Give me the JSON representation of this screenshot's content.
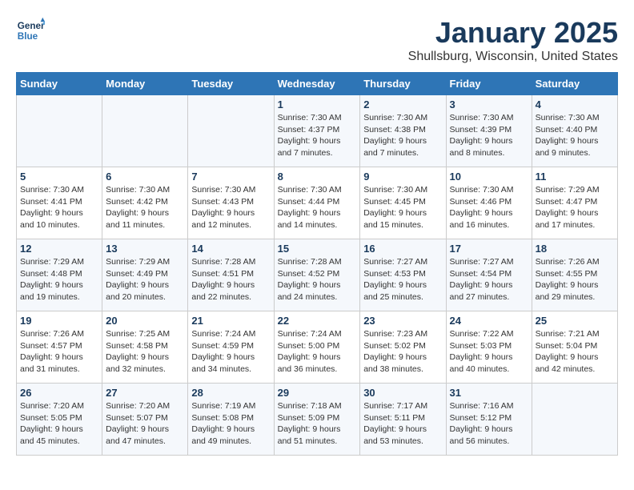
{
  "header": {
    "logo_line1": "General",
    "logo_line2": "Blue",
    "title": "January 2025",
    "subtitle": "Shullsburg, Wisconsin, United States"
  },
  "weekdays": [
    "Sunday",
    "Monday",
    "Tuesday",
    "Wednesday",
    "Thursday",
    "Friday",
    "Saturday"
  ],
  "weeks": [
    [
      {
        "day": "",
        "info": ""
      },
      {
        "day": "",
        "info": ""
      },
      {
        "day": "",
        "info": ""
      },
      {
        "day": "1",
        "info": "Sunrise: 7:30 AM\nSunset: 4:37 PM\nDaylight: 9 hours\nand 7 minutes."
      },
      {
        "day": "2",
        "info": "Sunrise: 7:30 AM\nSunset: 4:38 PM\nDaylight: 9 hours\nand 7 minutes."
      },
      {
        "day": "3",
        "info": "Sunrise: 7:30 AM\nSunset: 4:39 PM\nDaylight: 9 hours\nand 8 minutes."
      },
      {
        "day": "4",
        "info": "Sunrise: 7:30 AM\nSunset: 4:40 PM\nDaylight: 9 hours\nand 9 minutes."
      }
    ],
    [
      {
        "day": "5",
        "info": "Sunrise: 7:30 AM\nSunset: 4:41 PM\nDaylight: 9 hours\nand 10 minutes."
      },
      {
        "day": "6",
        "info": "Sunrise: 7:30 AM\nSunset: 4:42 PM\nDaylight: 9 hours\nand 11 minutes."
      },
      {
        "day": "7",
        "info": "Sunrise: 7:30 AM\nSunset: 4:43 PM\nDaylight: 9 hours\nand 12 minutes."
      },
      {
        "day": "8",
        "info": "Sunrise: 7:30 AM\nSunset: 4:44 PM\nDaylight: 9 hours\nand 14 minutes."
      },
      {
        "day": "9",
        "info": "Sunrise: 7:30 AM\nSunset: 4:45 PM\nDaylight: 9 hours\nand 15 minutes."
      },
      {
        "day": "10",
        "info": "Sunrise: 7:30 AM\nSunset: 4:46 PM\nDaylight: 9 hours\nand 16 minutes."
      },
      {
        "day": "11",
        "info": "Sunrise: 7:29 AM\nSunset: 4:47 PM\nDaylight: 9 hours\nand 17 minutes."
      }
    ],
    [
      {
        "day": "12",
        "info": "Sunrise: 7:29 AM\nSunset: 4:48 PM\nDaylight: 9 hours\nand 19 minutes."
      },
      {
        "day": "13",
        "info": "Sunrise: 7:29 AM\nSunset: 4:49 PM\nDaylight: 9 hours\nand 20 minutes."
      },
      {
        "day": "14",
        "info": "Sunrise: 7:28 AM\nSunset: 4:51 PM\nDaylight: 9 hours\nand 22 minutes."
      },
      {
        "day": "15",
        "info": "Sunrise: 7:28 AM\nSunset: 4:52 PM\nDaylight: 9 hours\nand 24 minutes."
      },
      {
        "day": "16",
        "info": "Sunrise: 7:27 AM\nSunset: 4:53 PM\nDaylight: 9 hours\nand 25 minutes."
      },
      {
        "day": "17",
        "info": "Sunrise: 7:27 AM\nSunset: 4:54 PM\nDaylight: 9 hours\nand 27 minutes."
      },
      {
        "day": "18",
        "info": "Sunrise: 7:26 AM\nSunset: 4:55 PM\nDaylight: 9 hours\nand 29 minutes."
      }
    ],
    [
      {
        "day": "19",
        "info": "Sunrise: 7:26 AM\nSunset: 4:57 PM\nDaylight: 9 hours\nand 31 minutes."
      },
      {
        "day": "20",
        "info": "Sunrise: 7:25 AM\nSunset: 4:58 PM\nDaylight: 9 hours\nand 32 minutes."
      },
      {
        "day": "21",
        "info": "Sunrise: 7:24 AM\nSunset: 4:59 PM\nDaylight: 9 hours\nand 34 minutes."
      },
      {
        "day": "22",
        "info": "Sunrise: 7:24 AM\nSunset: 5:00 PM\nDaylight: 9 hours\nand 36 minutes."
      },
      {
        "day": "23",
        "info": "Sunrise: 7:23 AM\nSunset: 5:02 PM\nDaylight: 9 hours\nand 38 minutes."
      },
      {
        "day": "24",
        "info": "Sunrise: 7:22 AM\nSunset: 5:03 PM\nDaylight: 9 hours\nand 40 minutes."
      },
      {
        "day": "25",
        "info": "Sunrise: 7:21 AM\nSunset: 5:04 PM\nDaylight: 9 hours\nand 42 minutes."
      }
    ],
    [
      {
        "day": "26",
        "info": "Sunrise: 7:20 AM\nSunset: 5:05 PM\nDaylight: 9 hours\nand 45 minutes."
      },
      {
        "day": "27",
        "info": "Sunrise: 7:20 AM\nSunset: 5:07 PM\nDaylight: 9 hours\nand 47 minutes."
      },
      {
        "day": "28",
        "info": "Sunrise: 7:19 AM\nSunset: 5:08 PM\nDaylight: 9 hours\nand 49 minutes."
      },
      {
        "day": "29",
        "info": "Sunrise: 7:18 AM\nSunset: 5:09 PM\nDaylight: 9 hours\nand 51 minutes."
      },
      {
        "day": "30",
        "info": "Sunrise: 7:17 AM\nSunset: 5:11 PM\nDaylight: 9 hours\nand 53 minutes."
      },
      {
        "day": "31",
        "info": "Sunrise: 7:16 AM\nSunset: 5:12 PM\nDaylight: 9 hours\nand 56 minutes."
      },
      {
        "day": "",
        "info": ""
      }
    ]
  ]
}
